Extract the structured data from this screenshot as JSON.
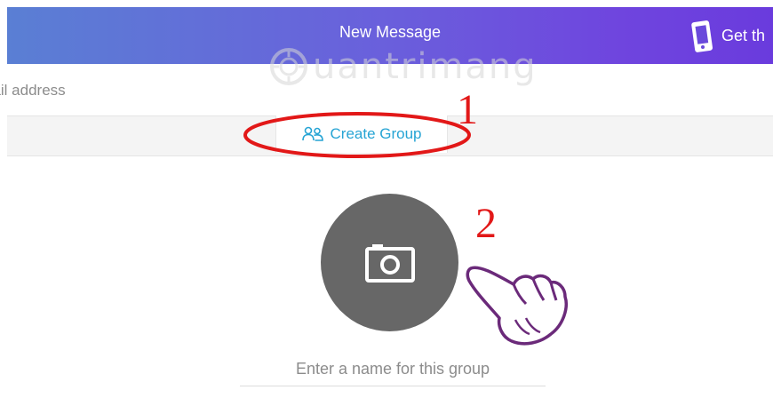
{
  "header": {
    "title": "New Message",
    "get_app_label": "Get th",
    "gradient_start": "#5a7fd4",
    "gradient_end": "#6a3bdd",
    "icons": {
      "get_app": "phone-icon"
    }
  },
  "watermark": {
    "text": "uantrimang",
    "icon": "gear-icon"
  },
  "recipient": {
    "placeholder": "nail address"
  },
  "create_group": {
    "label": "Create Group",
    "icon": "users-icon",
    "color": "#26a4d4"
  },
  "annotations": {
    "step1": "1",
    "step2": "2",
    "color": "#e21818"
  },
  "group": {
    "photo_icon": "camera-icon",
    "photo_bg": "#676767",
    "name_placeholder": "Enter a name for this group",
    "cursor_icon": "pointing-hand-icon"
  }
}
